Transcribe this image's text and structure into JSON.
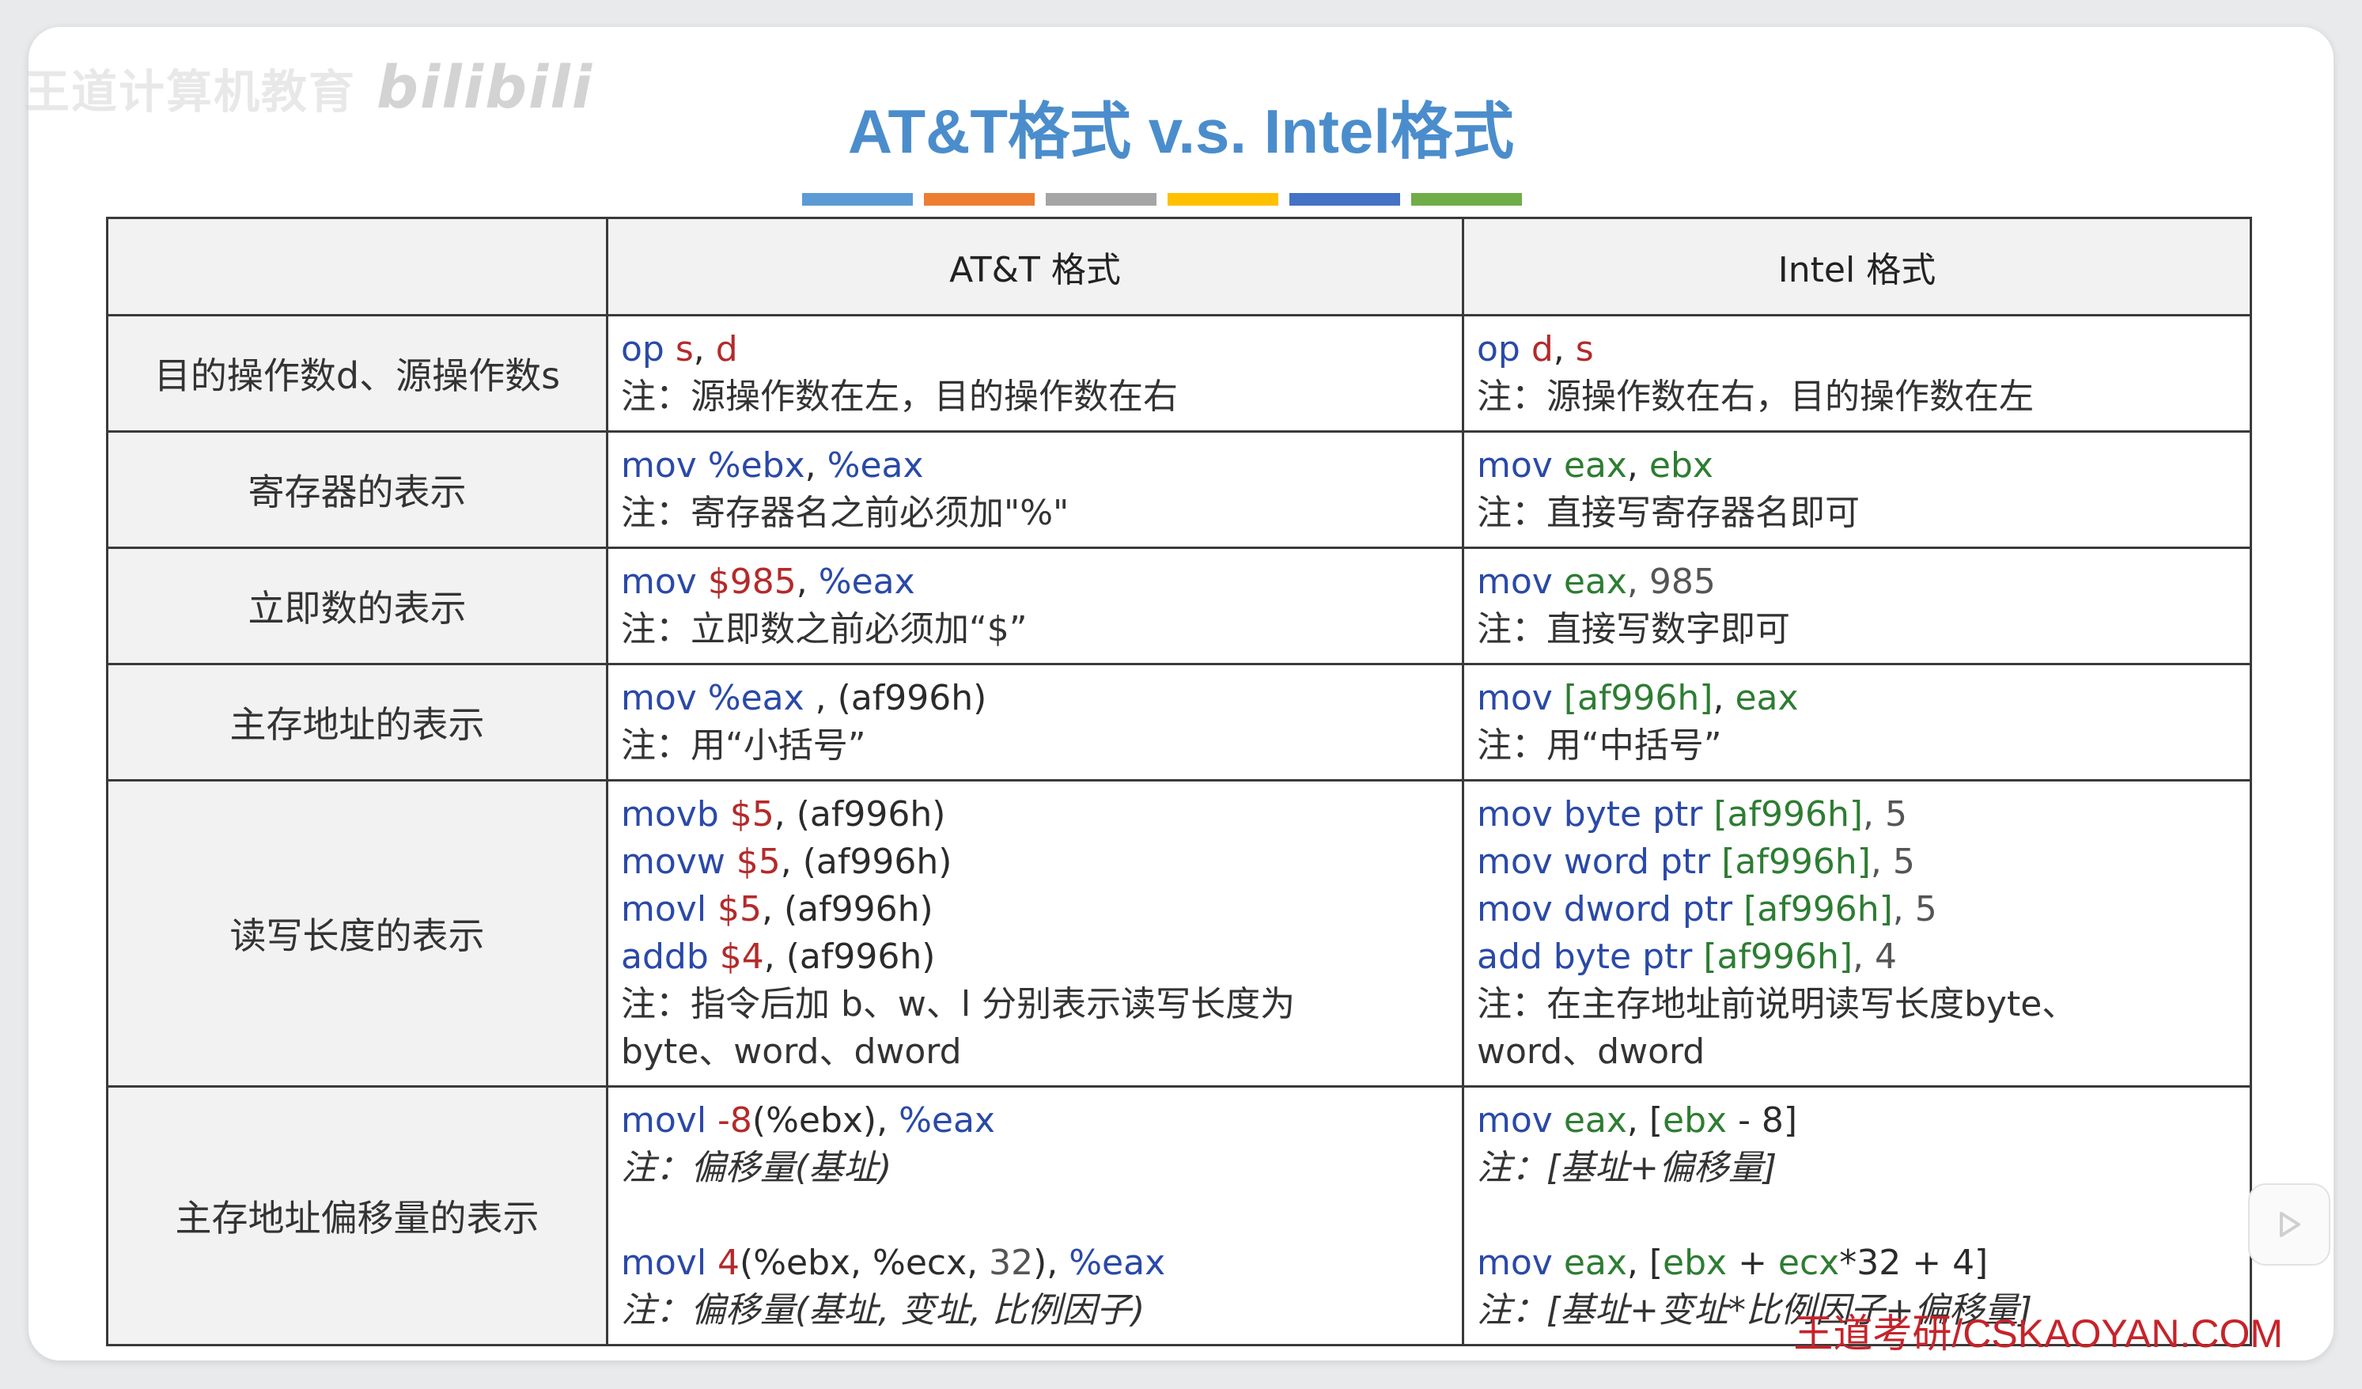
{
  "watermark": {
    "text": "王道计算机教育",
    "logo": "bilibili"
  },
  "title": "AT&T格式 v.s. Intel格式",
  "stripe_colors": [
    "#5b9bd5",
    "#ed7d31",
    "#a5a5a5",
    "#ffc000",
    "#4472c4",
    "#70ad47"
  ],
  "colors": {
    "blue": "#2a49a8",
    "red": "#b42a2a",
    "green": "#2d7d32",
    "title": "#4b8dcc"
  },
  "header": {
    "empty": "",
    "att": "AT&T 格式",
    "intel": "Intel 格式"
  },
  "rows": [
    {
      "label": "目的操作数d、源操作数s",
      "att": [
        [
          [
            "op ",
            "blue"
          ],
          [
            "s",
            "red"
          ],
          [
            ", ",
            "dark"
          ],
          [
            "d",
            "red"
          ]
        ],
        [
          [
            "注：源操作数在左，目的操作数在右",
            "note"
          ]
        ]
      ],
      "intel": [
        [
          [
            "op ",
            "blue"
          ],
          [
            "d",
            "red"
          ],
          [
            ", ",
            "dark"
          ],
          [
            "s",
            "red"
          ]
        ],
        [
          [
            "注：源操作数在右，目的操作数在左",
            "note"
          ]
        ]
      ]
    },
    {
      "label": "寄存器的表示",
      "att": [
        [
          [
            "mov %ebx",
            "blue"
          ],
          [
            ", ",
            "dark"
          ],
          [
            "%eax",
            "blue"
          ]
        ],
        [
          [
            "注：寄存器名之前必须加\"%\"",
            "note"
          ]
        ]
      ],
      "intel": [
        [
          [
            "mov ",
            "blue"
          ],
          [
            "eax",
            "green"
          ],
          [
            ", ",
            "dark"
          ],
          [
            "ebx",
            "green"
          ]
        ],
        [
          [
            "注：直接写寄存器名即可",
            "note"
          ]
        ]
      ]
    },
    {
      "label": "立即数的表示",
      "att": [
        [
          [
            "mov ",
            "blue"
          ],
          [
            "$985",
            "red"
          ],
          [
            ", ",
            "dark"
          ],
          [
            "%eax",
            "blue"
          ]
        ],
        [
          [
            "注：立即数之前必须加“$”",
            "note"
          ]
        ]
      ],
      "intel": [
        [
          [
            "mov ",
            "blue"
          ],
          [
            "eax",
            "green"
          ],
          [
            ", 985",
            "gray"
          ]
        ],
        [
          [
            "注：直接写数字即可",
            "note"
          ]
        ]
      ]
    },
    {
      "label": "主存地址的表示",
      "att": [
        [
          [
            "mov %eax",
            "blue"
          ],
          [
            " , (af996h)",
            "dark"
          ]
        ],
        [
          [
            "注：用“小括号”",
            "note"
          ]
        ]
      ],
      "intel": [
        [
          [
            "mov ",
            "blue"
          ],
          [
            "[af996h]",
            "green"
          ],
          [
            ", ",
            "dark"
          ],
          [
            "eax",
            "green"
          ]
        ],
        [
          [
            "注：用“中括号”",
            "note"
          ]
        ]
      ]
    },
    {
      "label": "读写长度的表示",
      "att": [
        [
          [
            "movb ",
            "blue"
          ],
          [
            "$5",
            "red"
          ],
          [
            ", (af996h)",
            "dark"
          ]
        ],
        [
          [
            "movw ",
            "blue"
          ],
          [
            "$5",
            "red"
          ],
          [
            ", (af996h)",
            "dark"
          ]
        ],
        [
          [
            "movl ",
            "blue"
          ],
          [
            "$5",
            "red"
          ],
          [
            ", (af996h)",
            "dark"
          ]
        ],
        [
          [
            "addb ",
            "blue"
          ],
          [
            "$4",
            "red"
          ],
          [
            ", (af996h)",
            "dark"
          ]
        ],
        [
          [
            "注：指令后加 b、w、l 分别表示读写长度为",
            "note"
          ]
        ],
        [
          [
            "byte、word、dword",
            "note"
          ]
        ]
      ],
      "intel": [
        [
          [
            "mov byte ptr ",
            "blue"
          ],
          [
            "[af996h]",
            "green"
          ],
          [
            ", 5",
            "gray"
          ]
        ],
        [
          [
            "mov word ptr ",
            "blue"
          ],
          [
            "[af996h]",
            "green"
          ],
          [
            ", 5",
            "gray"
          ]
        ],
        [
          [
            "mov dword ptr ",
            "blue"
          ],
          [
            "[af996h]",
            "green"
          ],
          [
            ", 5",
            "gray"
          ]
        ],
        [
          [
            "add byte ptr ",
            "blue"
          ],
          [
            "[af996h]",
            "green"
          ],
          [
            ", 4",
            "gray"
          ]
        ],
        [
          [
            "注：在主存地址前说明读写长度byte、",
            "note"
          ]
        ],
        [
          [
            "word、dword",
            "note"
          ]
        ]
      ]
    },
    {
      "label": "主存地址偏移量的表示",
      "att": [
        [
          [
            "movl ",
            "blue"
          ],
          [
            "-8",
            "red"
          ],
          [
            "(%ebx), ",
            "dark"
          ],
          [
            "%eax",
            "blue"
          ]
        ],
        [
          [
            "注：偏移量(基址)",
            "note it"
          ]
        ],
        [],
        [
          [
            "movl ",
            "blue"
          ],
          [
            "4",
            "red"
          ],
          [
            "(%ebx, %ecx, ",
            "dark"
          ],
          [
            "32",
            "gray"
          ],
          [
            "), ",
            "dark"
          ],
          [
            "%eax",
            "blue"
          ]
        ],
        [
          [
            "注：偏移量(基址, 变址, 比例因子)",
            "note it"
          ]
        ]
      ],
      "intel": [
        [
          [
            "mov ",
            "blue"
          ],
          [
            "eax",
            "green"
          ],
          [
            ", [",
            "dark"
          ],
          [
            "ebx",
            "green"
          ],
          [
            " - 8]",
            "dark"
          ]
        ],
        [
          [
            "注：[基址+偏移量]",
            "note it"
          ]
        ],
        [],
        [
          [
            "mov ",
            "blue"
          ],
          [
            "eax",
            "green"
          ],
          [
            ", [",
            "dark"
          ],
          [
            "ebx",
            "green"
          ],
          [
            " + ",
            "dark"
          ],
          [
            "ecx",
            "green"
          ],
          [
            "*32 + 4]",
            "dark"
          ]
        ],
        [
          [
            "注：[基址+变址*比例因子+偏移量]",
            "note it"
          ]
        ]
      ]
    }
  ],
  "footer": "王道考研/CSKAOYAN.COM",
  "play_icon": "play-icon"
}
